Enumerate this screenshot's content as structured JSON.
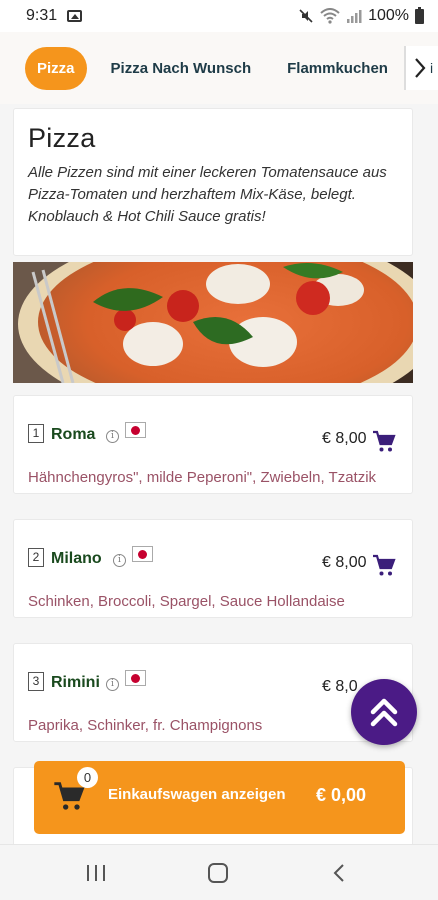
{
  "status_bar": {
    "time": "9:31",
    "battery": "100%",
    "icons": [
      "image-icon",
      "mute-icon",
      "wifi-icon",
      "signal-icon",
      "battery-icon"
    ]
  },
  "tabs": [
    {
      "label": "Pizza",
      "active": true
    },
    {
      "label": "Pizza Nach Wunsch",
      "active": false
    },
    {
      "label": "Flammkuchen",
      "active": false
    }
  ],
  "tabs_next_partial": "i",
  "section": {
    "title": "Pizza",
    "description": "Alle Pizzen sind mit einer leckeren Tomatensauce aus Pizza-Tomaten und herzhaftem Mix-Käse, belegt. Knoblauch & Hot Chili Sauce gratis!"
  },
  "items": [
    {
      "number": "1",
      "name": "Roma",
      "price": "€ 8,00",
      "description": "Hähnchengyros\", milde Peperoni\", Zwiebeln, Tzatzik"
    },
    {
      "number": "2",
      "name": "Milano",
      "price": "€ 8,00",
      "description": "Schinken, Broccoli, Spargel, Sauce Hollandaise"
    },
    {
      "number": "3",
      "name": "Rimini",
      "price": "€ 8,0",
      "description": "Paprika, Schinker, fr. Champignons"
    }
  ],
  "cart": {
    "count": "0",
    "label": "Einkaufswagen anzeigen",
    "total": "€ 0,00"
  },
  "colors": {
    "accent_orange": "#f5951c",
    "fab_purple": "#4b1b86",
    "item_name_green": "#1a4a1e",
    "description_mauve": "#9a5266",
    "cart_icon_purple": "#3b1e7a"
  }
}
